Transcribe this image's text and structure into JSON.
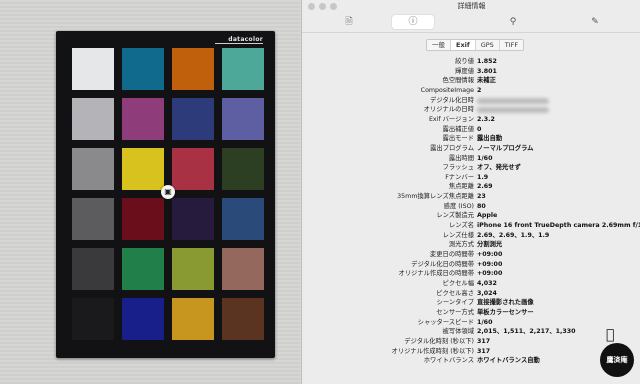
{
  "window": {
    "title": "詳細情報",
    "toolbar": [
      {
        "icon": "document-icon"
      },
      {
        "icon": "info-icon",
        "selected": true
      },
      {
        "icon": "search-icon"
      },
      {
        "icon": "pen-icon"
      }
    ],
    "tabs": [
      {
        "label": "一般",
        "selected": false
      },
      {
        "label": "Exif",
        "selected": true
      },
      {
        "label": "GPS",
        "selected": false
      },
      {
        "label": "TIFF",
        "selected": false
      }
    ]
  },
  "exif_rows": [
    {
      "label": "絞り値",
      "value": "1.852"
    },
    {
      "label": "輝度値",
      "value": "3.801"
    },
    {
      "label": "色空間情報",
      "value": "未補正"
    },
    {
      "label": "CompositeImage",
      "value": "2"
    },
    {
      "label": "デジタル化日時",
      "value": "",
      "redacted": true
    },
    {
      "label": "オリジナルの日時",
      "value": "",
      "redacted": true
    },
    {
      "label": "Exif バージョン",
      "value": "2.3.2"
    },
    {
      "label": "露出補正値",
      "value": "0"
    },
    {
      "label": "露出モード",
      "value": "露出自動"
    },
    {
      "label": "露出プログラム",
      "value": "ノーマルプログラム"
    },
    {
      "label": "露出時間",
      "value": "1/60"
    },
    {
      "label": "フラッシュ",
      "value": "オフ、発光せず"
    },
    {
      "label": "Fナンバー",
      "value": "1.9"
    },
    {
      "label": "焦点距離",
      "value": "2.69"
    },
    {
      "label": "35mm換算レンズ焦点距離",
      "value": "23"
    },
    {
      "label": "感度 (ISO)",
      "value": "80"
    },
    {
      "label": "レンズ製造元",
      "value": "Apple"
    },
    {
      "label": "レンズ名",
      "value": "iPhone 16 front TrueDepth camera 2.69mm f/1.9"
    },
    {
      "label": "レンズ仕様",
      "value": "2.69、2.69、1.9、1.9"
    },
    {
      "label": "測光方式",
      "value": "分割測光"
    },
    {
      "label": "変更日の時間帯",
      "value": "+09:00"
    },
    {
      "label": "デジタル化日の時間帯",
      "value": "+09:00"
    },
    {
      "label": "オリジナル作成日の時間帯",
      "value": "+09:00"
    },
    {
      "label": "ピクセル幅",
      "value": "4,032"
    },
    {
      "label": "ピクセル高さ",
      "value": "3,024"
    },
    {
      "label": "シーンタイプ",
      "value": "直接撮影された画像"
    },
    {
      "label": "センサー方式",
      "value": "単板カラーセンサー"
    },
    {
      "label": "シャッタースピード",
      "value": "1/60"
    },
    {
      "label": "被写体領域",
      "value": "2,015、1,511、2,217、1,330"
    },
    {
      "label": "デジタル化時刻 (秒以下)",
      "value": "317"
    },
    {
      "label": "オリジナル作成時刻 (秒以下)",
      "value": "317"
    },
    {
      "label": "ホワイトバランス",
      "value": "ホワイトバランス自動"
    }
  ],
  "photo": {
    "brand": "datacolor",
    "patches": [
      [
        "#e6e7e9",
        "#0f6a8d",
        "#c0600d",
        "#4ea89a"
      ],
      [
        "#b4b4b8",
        "#8e3d7a",
        "#2e3b7a",
        "#5d5fa2"
      ],
      [
        "#8a8a8c",
        "#d8c31e",
        "#a83244",
        "#2d3f22"
      ],
      [
        "#5c5c5e",
        "#6a0e1b",
        "#261a3d",
        "#2a4a79"
      ],
      [
        "#3a3a3c",
        "#21804a",
        "#8a9a33",
        "#94685c"
      ],
      [
        "#1a1a1c",
        "#181e8a",
        "#c7961e",
        "#5a3421"
      ]
    ]
  },
  "watermark": {
    "text": "鷹済庵"
  }
}
